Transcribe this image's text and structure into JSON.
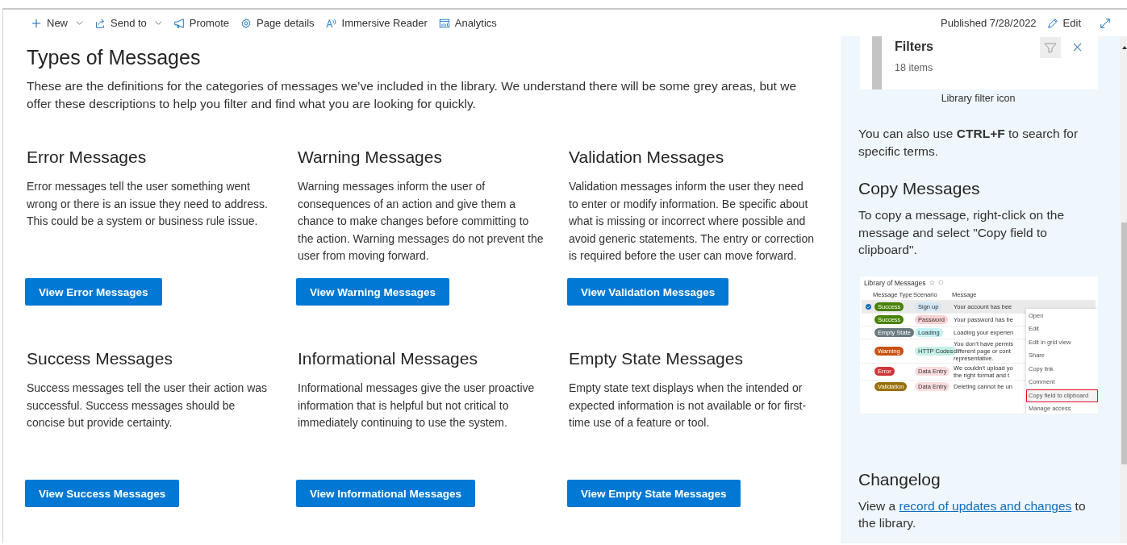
{
  "toolbar": {
    "items": [
      {
        "label": "New",
        "caret": true
      },
      {
        "label": "Send to",
        "caret": true
      },
      {
        "label": "Promote",
        "caret": false
      },
      {
        "label": "Page details",
        "caret": false
      },
      {
        "label": "Immersive Reader",
        "caret": false
      },
      {
        "label": "Analytics",
        "caret": false
      }
    ],
    "published": "Published 7/28/2022",
    "edit": "Edit"
  },
  "main": {
    "title": "Types of Messages",
    "intro": "These are the definitions for the categories of messages we’ve included in the library. We understand there will be some grey areas, but we offer these descriptions to help you filter and find what you are looking for quickly.",
    "categories": [
      {
        "title": "Error Messages",
        "description": "Error messages tell the user something went wrong or there is an issue they need to address. This could be a system or business rule issue.",
        "button": "View Error Messages"
      },
      {
        "title": "Warning Messages",
        "description": "Warning messages inform the user of consequences of an action and give them a chance to make changes before committing to the action. Warning messages do not prevent the user from moving forward.",
        "button": "View Warning Messages"
      },
      {
        "title": "Validation Messages",
        "description": "Validation messages inform the user they need to enter or modify information. Be specific about what is missing or incorrect where possible and avoid generic statements. The entry or correction is required before the user can move forward.",
        "button": "View Validation Messages"
      },
      {
        "title": "Success Messages",
        "description": "Success messages tell the user their action was successful. Success messages should be concise but provide certainty.",
        "button": "View Success Messages"
      },
      {
        "title": "Informational Messages",
        "description": "Informational messages give the user proactive information that is helpful but not critical to immediately continuing to use the system.",
        "button": "View Informational Messages"
      },
      {
        "title": "Empty State Messages",
        "description": "Empty state text displays when the intended or expected information is not available or for first-time use of a feature or tool.",
        "button": "View Empty State Messages"
      }
    ]
  },
  "sidebar": {
    "filter_image": {
      "title": "Filters",
      "count": "18 items",
      "caption": "Library filter icon"
    },
    "search_tip": "You can also use **CTRL+F** to search for specific terms.",
    "copy": {
      "title": "Copy Messages",
      "text": "To copy a message, right-click on the message and select \"Copy field to clipboard\".",
      "screenshot": {
        "title": "Library of Messages",
        "columns": [
          "Message Type",
          "Scenario",
          "Message"
        ],
        "rows": [
          {
            "selected": true,
            "type": {
              "label": "Success",
              "color": "#498205"
            },
            "scenario": {
              "label": "Sign up",
              "color": "#d4e7f6"
            },
            "message": [
              "Your account has bee"
            ]
          },
          {
            "selected": false,
            "type": {
              "label": "Success",
              "color": "#498205"
            },
            "scenario": {
              "label": "Password",
              "color": "#f9d1d4"
            },
            "message": [
              "Your password has be"
            ]
          },
          {
            "selected": false,
            "type": {
              "label": "Empty State",
              "color": "#69797e"
            },
            "scenario": {
              "label": "Loading",
              "color": "#c5f3f6"
            },
            "message": [
              "Loading your experien"
            ]
          },
          {
            "selected": false,
            "type": {
              "label": "Warning",
              "color": "#ca5010"
            },
            "scenario": {
              "label": "HTTP Codes",
              "color": "#c3f0e6"
            },
            "message": [
              "You don’t have permis",
              "different page or cont",
              "representative."
            ]
          },
          {
            "selected": false,
            "type": {
              "label": "Error",
              "color": "#d13438"
            },
            "scenario": {
              "label": "Data Entry",
              "color": "#fbdcdc"
            },
            "message": [
              "We couldn’t upload yo",
              "the right format and t"
            ]
          },
          {
            "selected": false,
            "type": {
              "label": "Validation",
              "color": "#986f0b"
            },
            "scenario": {
              "label": "Data Entry",
              "color": "#fbdcdc"
            },
            "message": [
              "Deleting cannot be un"
            ]
          }
        ],
        "menu": [
          {
            "label": "Open",
            "selected": false
          },
          {
            "label": "Edit",
            "selected": false
          },
          {
            "label": "Edit in grid view",
            "selected": false
          },
          {
            "label": "Share",
            "selected": false
          },
          {
            "label": "Copy link",
            "selected": false
          },
          {
            "label": "Comment",
            "selected": false
          },
          {
            "label": "Copy field to clipboard",
            "selected": true
          },
          {
            "label": "Manage access",
            "selected": false
          }
        ]
      }
    },
    "changelog": {
      "title": "Changelog",
      "before": "View a ",
      "link": "record of updates and changes",
      "after": " to the library."
    }
  }
}
